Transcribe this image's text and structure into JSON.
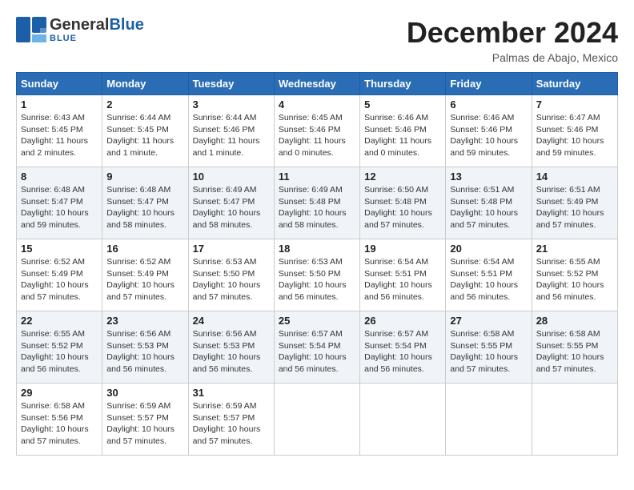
{
  "header": {
    "logo_general": "General",
    "logo_blue": "Blue",
    "month_title": "December 2024",
    "location": "Palmas de Abajo, Mexico"
  },
  "days_of_week": [
    "Sunday",
    "Monday",
    "Tuesday",
    "Wednesday",
    "Thursday",
    "Friday",
    "Saturday"
  ],
  "weeks": [
    [
      {
        "day": "1",
        "info": "Sunrise: 6:43 AM\nSunset: 5:45 PM\nDaylight: 11 hours\nand 2 minutes."
      },
      {
        "day": "2",
        "info": "Sunrise: 6:44 AM\nSunset: 5:45 PM\nDaylight: 11 hours\nand 1 minute."
      },
      {
        "day": "3",
        "info": "Sunrise: 6:44 AM\nSunset: 5:46 PM\nDaylight: 11 hours\nand 1 minute."
      },
      {
        "day": "4",
        "info": "Sunrise: 6:45 AM\nSunset: 5:46 PM\nDaylight: 11 hours\nand 0 minutes."
      },
      {
        "day": "5",
        "info": "Sunrise: 6:46 AM\nSunset: 5:46 PM\nDaylight: 11 hours\nand 0 minutes."
      },
      {
        "day": "6",
        "info": "Sunrise: 6:46 AM\nSunset: 5:46 PM\nDaylight: 10 hours\nand 59 minutes."
      },
      {
        "day": "7",
        "info": "Sunrise: 6:47 AM\nSunset: 5:46 PM\nDaylight: 10 hours\nand 59 minutes."
      }
    ],
    [
      {
        "day": "8",
        "info": "Sunrise: 6:48 AM\nSunset: 5:47 PM\nDaylight: 10 hours\nand 59 minutes."
      },
      {
        "day": "9",
        "info": "Sunrise: 6:48 AM\nSunset: 5:47 PM\nDaylight: 10 hours\nand 58 minutes."
      },
      {
        "day": "10",
        "info": "Sunrise: 6:49 AM\nSunset: 5:47 PM\nDaylight: 10 hours\nand 58 minutes."
      },
      {
        "day": "11",
        "info": "Sunrise: 6:49 AM\nSunset: 5:48 PM\nDaylight: 10 hours\nand 58 minutes."
      },
      {
        "day": "12",
        "info": "Sunrise: 6:50 AM\nSunset: 5:48 PM\nDaylight: 10 hours\nand 57 minutes."
      },
      {
        "day": "13",
        "info": "Sunrise: 6:51 AM\nSunset: 5:48 PM\nDaylight: 10 hours\nand 57 minutes."
      },
      {
        "day": "14",
        "info": "Sunrise: 6:51 AM\nSunset: 5:49 PM\nDaylight: 10 hours\nand 57 minutes."
      }
    ],
    [
      {
        "day": "15",
        "info": "Sunrise: 6:52 AM\nSunset: 5:49 PM\nDaylight: 10 hours\nand 57 minutes."
      },
      {
        "day": "16",
        "info": "Sunrise: 6:52 AM\nSunset: 5:49 PM\nDaylight: 10 hours\nand 57 minutes."
      },
      {
        "day": "17",
        "info": "Sunrise: 6:53 AM\nSunset: 5:50 PM\nDaylight: 10 hours\nand 57 minutes."
      },
      {
        "day": "18",
        "info": "Sunrise: 6:53 AM\nSunset: 5:50 PM\nDaylight: 10 hours\nand 56 minutes."
      },
      {
        "day": "19",
        "info": "Sunrise: 6:54 AM\nSunset: 5:51 PM\nDaylight: 10 hours\nand 56 minutes."
      },
      {
        "day": "20",
        "info": "Sunrise: 6:54 AM\nSunset: 5:51 PM\nDaylight: 10 hours\nand 56 minutes."
      },
      {
        "day": "21",
        "info": "Sunrise: 6:55 AM\nSunset: 5:52 PM\nDaylight: 10 hours\nand 56 minutes."
      }
    ],
    [
      {
        "day": "22",
        "info": "Sunrise: 6:55 AM\nSunset: 5:52 PM\nDaylight: 10 hours\nand 56 minutes."
      },
      {
        "day": "23",
        "info": "Sunrise: 6:56 AM\nSunset: 5:53 PM\nDaylight: 10 hours\nand 56 minutes."
      },
      {
        "day": "24",
        "info": "Sunrise: 6:56 AM\nSunset: 5:53 PM\nDaylight: 10 hours\nand 56 minutes."
      },
      {
        "day": "25",
        "info": "Sunrise: 6:57 AM\nSunset: 5:54 PM\nDaylight: 10 hours\nand 56 minutes."
      },
      {
        "day": "26",
        "info": "Sunrise: 6:57 AM\nSunset: 5:54 PM\nDaylight: 10 hours\nand 56 minutes."
      },
      {
        "day": "27",
        "info": "Sunrise: 6:58 AM\nSunset: 5:55 PM\nDaylight: 10 hours\nand 57 minutes."
      },
      {
        "day": "28",
        "info": "Sunrise: 6:58 AM\nSunset: 5:55 PM\nDaylight: 10 hours\nand 57 minutes."
      }
    ],
    [
      {
        "day": "29",
        "info": "Sunrise: 6:58 AM\nSunset: 5:56 PM\nDaylight: 10 hours\nand 57 minutes."
      },
      {
        "day": "30",
        "info": "Sunrise: 6:59 AM\nSunset: 5:57 PM\nDaylight: 10 hours\nand 57 minutes."
      },
      {
        "day": "31",
        "info": "Sunrise: 6:59 AM\nSunset: 5:57 PM\nDaylight: 10 hours\nand 57 minutes."
      },
      {
        "day": "",
        "info": ""
      },
      {
        "day": "",
        "info": ""
      },
      {
        "day": "",
        "info": ""
      },
      {
        "day": "",
        "info": ""
      }
    ]
  ]
}
